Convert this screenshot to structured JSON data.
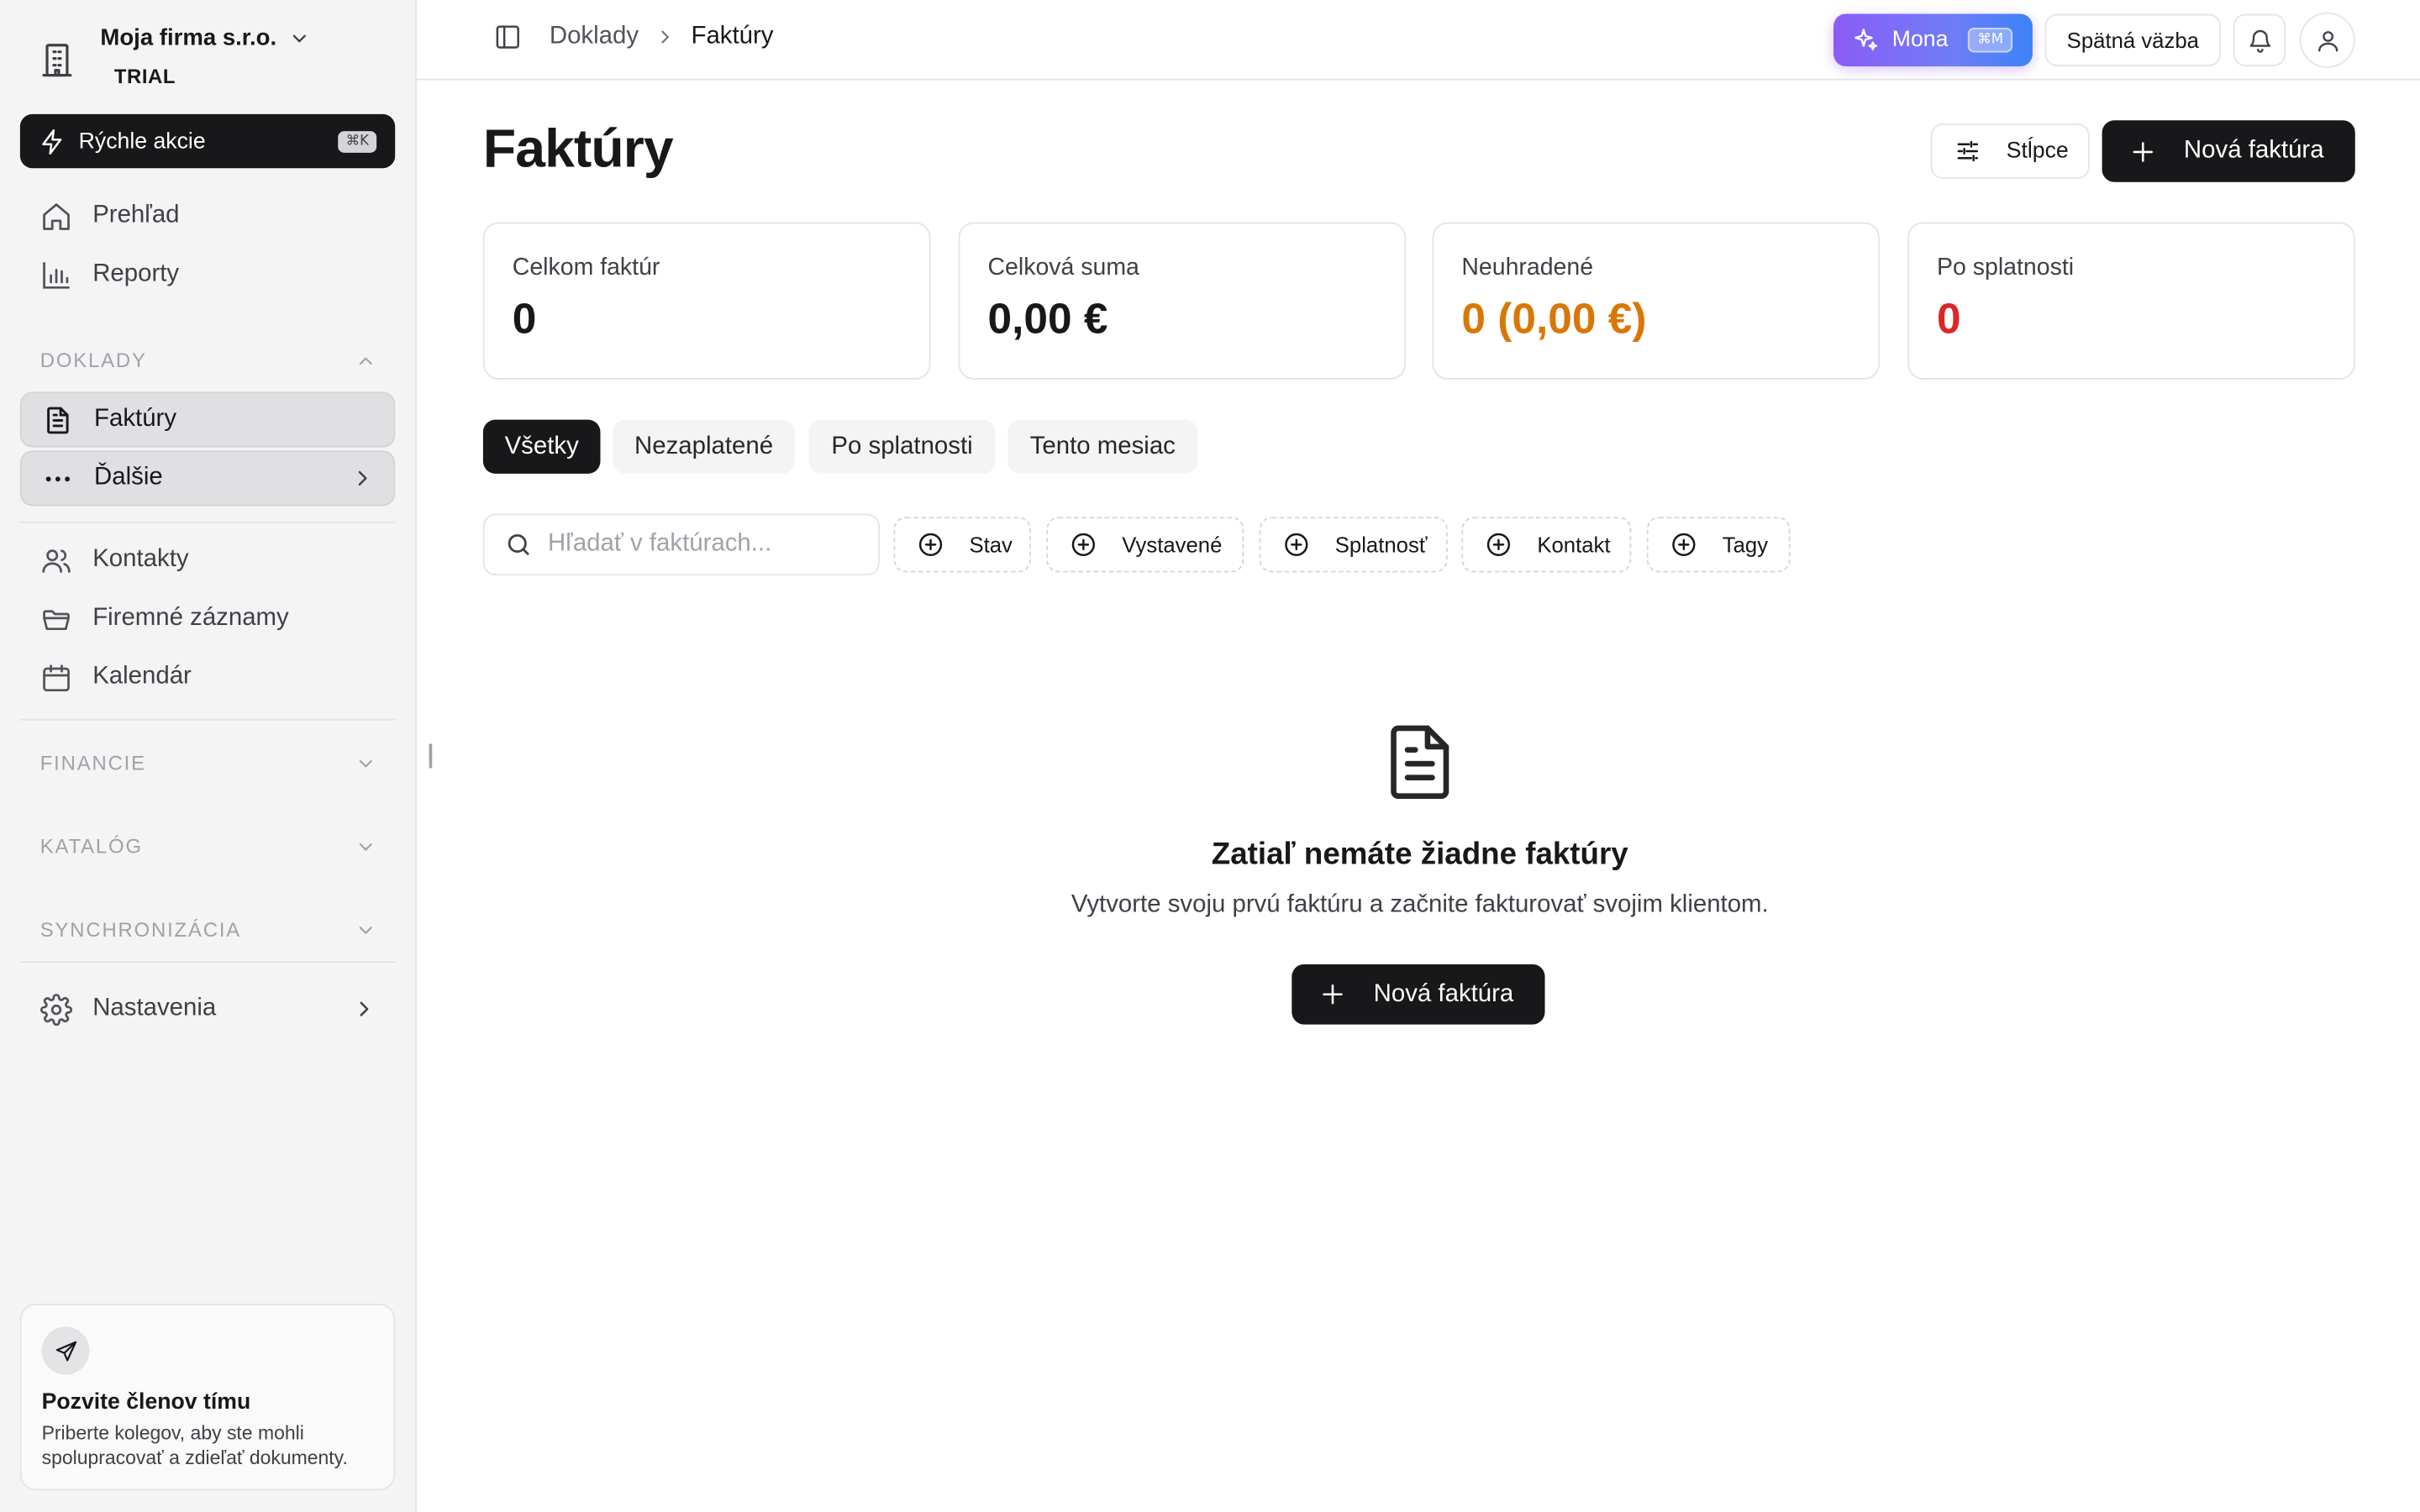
{
  "sidebar": {
    "company_name": "Moja firma s.r.o.",
    "company_plan": "TRIAL",
    "quick_actions": {
      "label": "Rýchle akcie",
      "shortcut": "⌘K"
    },
    "top_items": [
      {
        "label": "Prehľad",
        "icon": "home-icon"
      },
      {
        "label": "Reporty",
        "icon": "bar-chart-icon"
      }
    ],
    "sections": {
      "doklady": "DOKLADY",
      "financie": "FINANCIE",
      "katalog": "KATALÓG",
      "synchronizacia": "SYNCHRONIZÁCIA"
    },
    "doklady_items": [
      {
        "label": "Faktúry",
        "icon": "file-text-icon",
        "active": true
      },
      {
        "label": "Ďalšie",
        "icon": "more-horizontal-icon",
        "active": false
      }
    ],
    "mid_items": [
      {
        "label": "Kontakty",
        "icon": "users-icon"
      },
      {
        "label": "Firemné záznamy",
        "icon": "folder-icon"
      },
      {
        "label": "Kalendár",
        "icon": "calendar-icon"
      }
    ],
    "settings_label": "Nastavenia",
    "invite": {
      "title": "Pozvite členov tímu",
      "text": "Priberte kolegov, aby ste mohli spolupracovať a zdieľať dokumenty."
    }
  },
  "topbar": {
    "breadcrumb_parent": "Doklady",
    "breadcrumb_current": "Faktúry",
    "mona_label": "Mona",
    "mona_shortcut": "⌘M",
    "feedback_label": "Spätná väzba"
  },
  "page": {
    "title": "Faktúry",
    "columns_label": "Stĺpce",
    "new_invoice_label": "Nová faktúra"
  },
  "stats": [
    {
      "label": "Celkom faktúr",
      "value": "0",
      "color": "#18181b"
    },
    {
      "label": "Celková suma",
      "value": "0,00 €",
      "color": "#18181b"
    },
    {
      "label": "Neuhradené",
      "value": "0 (0,00 €)",
      "color": "#d97706"
    },
    {
      "label": "Po splatnosti",
      "value": "0",
      "color": "#dc2626"
    }
  ],
  "tabs": [
    "Všetky",
    "Nezaplatené",
    "Po splatnosti",
    "Tento mesiac"
  ],
  "search": {
    "placeholder": "Hľadať v faktúrach..."
  },
  "filters": [
    "Stav",
    "Vystavené",
    "Splatnosť",
    "Kontakt",
    "Tagy"
  ],
  "empty": {
    "title": "Zatiaľ nemáte žiadne faktúry",
    "text": "Vytvorte svoju prvú faktúru a začnite fakturovať svojim klientom.",
    "button_label": "Nová faktúra"
  }
}
